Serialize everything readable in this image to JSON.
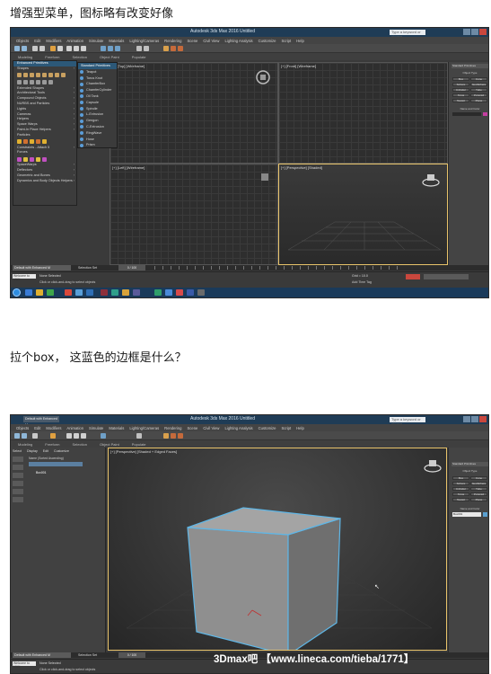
{
  "captions": {
    "first": "增强型菜单，图标略有改变好像",
    "second": "拉个box，  这蓝色的边框是什么？"
  },
  "app": {
    "title": "Autodesk 3ds Max 2016    Untitled",
    "search_placeholder": "Type a keyword or phrase",
    "menus": [
      "Objects",
      "Edit",
      "Modifiers",
      "Animation",
      "Simulate",
      "Materials",
      "Lighting/Cameras",
      "Rendering",
      "Scene",
      "Civil View",
      "Lighting Analysis",
      "Customize",
      "Script",
      "Help"
    ],
    "ribbon_tabs": [
      "Modeling",
      "Freeform",
      "Selection",
      "Object Paint",
      "Populate"
    ],
    "workspace": "Default with Enhanced M",
    "selection_label": "Selection Set",
    "status_text": "None Selected",
    "prompt_text": "Click or click-and-drag to select objects",
    "welcome": "Welcome to MAX",
    "add_time_tag": "Add Time Tag",
    "frame_counter": "0 / 100",
    "grid_value": "Grid = 10.0",
    "accent_color": "#e8c36a",
    "highlight_color": "#5fb6e6"
  },
  "shot1": {
    "viewports": {
      "top": "[+] [Top] [Wireframe]",
      "front": "[+] [Front] [Wireframe]",
      "left": "[+] [Left] [Wireframe]",
      "perspective": "[+] [Perspective] [Shaded]"
    },
    "enhanced_menu": {
      "header": "Enhanced Primitives",
      "items": [
        "Shapes",
        "Extended Shapes",
        "Architectural Tools",
        "Compound Objects",
        "NURBS and Particles",
        "Lights",
        "Cameras",
        "Helpers",
        "Space Warps",
        "Paint-In Place Helpers",
        "Particles",
        "Constraints - Attach 5",
        "Forces",
        "SpaceWarps",
        "Deflectors",
        "Geometric and Bones",
        "Dynamics and Body Objects Helpers"
      ]
    },
    "submenu": {
      "header": "Standard Primitives",
      "items": [
        "Teapot",
        "Torus Knot",
        "ChamferBox",
        "ChamferCylinder",
        "Oil Tank",
        "Capsule",
        "Spindle",
        "L-Extrusion",
        "Gengon",
        "C-Extrusion",
        "RingWave",
        "Hose",
        "Prism"
      ]
    },
    "command_panel": {
      "dropdown": "Standard Primitives",
      "rollout": "Object Type",
      "buttons": [
        "Box",
        "Cone",
        "Sphere",
        "GeoSphere",
        "Cylinder",
        "Tube",
        "Torus",
        "Pyramid",
        "Teapot",
        "Plane"
      ],
      "name_rollout": "Name and Color"
    }
  },
  "shot2": {
    "viewport_label": "[+] [Perspective] [Shaded + Edged Faces]",
    "scene_explorer": {
      "tabs": [
        "Select",
        "Display",
        "Edit",
        "Customize"
      ],
      "column": "Name (Sorted Ascending)",
      "item": "Box001"
    },
    "command_panel": {
      "dropdown": "Standard Primitives",
      "rollout": "Object Type",
      "name_field": "Box001"
    },
    "watermark": "3Dmax吧 【www.lineca.com/tieba/1771】"
  }
}
